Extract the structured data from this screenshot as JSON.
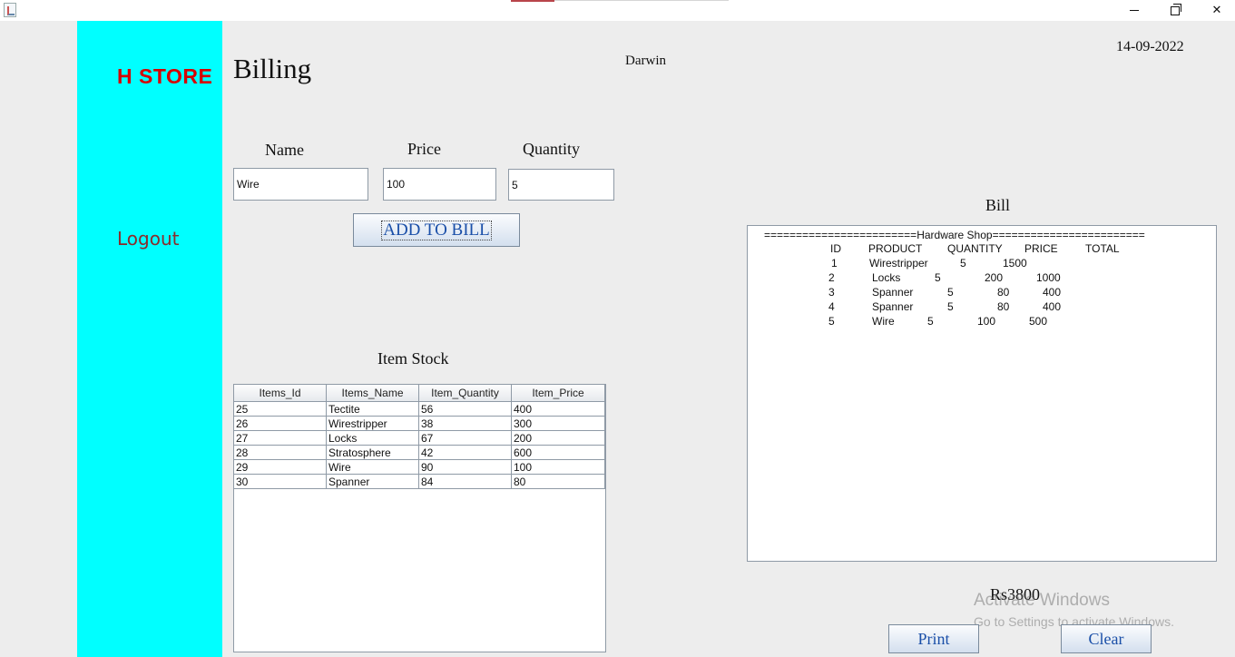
{
  "window": {
    "minimize_glyph": "",
    "restore_glyph": "",
    "close_glyph": "✕"
  },
  "sidebar": {
    "brand": "H STORE",
    "logout_label": "Logout"
  },
  "header": {
    "title": "Billing",
    "user": "Darwin",
    "date": "14-09-2022"
  },
  "form": {
    "name_label": "Name",
    "price_label": "Price",
    "quantity_label": "Quantity",
    "name_value": "Wire",
    "price_value": "100",
    "quantity_value": "5",
    "add_button": "ADD TO BILL"
  },
  "stock": {
    "title": "Item Stock",
    "columns": [
      "Items_Id",
      "Items_Name",
      "Item_Quantity",
      "Item_Price"
    ],
    "rows": [
      [
        "25",
        "Tectite",
        "56",
        "400"
      ],
      [
        "26",
        "Wirestripper",
        "38",
        "300"
      ],
      [
        "27",
        "Locks",
        "67",
        "200"
      ],
      [
        "28",
        "Stratosphere",
        "42",
        "600"
      ],
      [
        "29",
        "Wire",
        "90",
        "100"
      ],
      [
        "30",
        "Spanner",
        "84",
        "80"
      ]
    ]
  },
  "bill": {
    "title": "Bill",
    "banner": "========================Hardware Shop========================",
    "headers": [
      "ID",
      "PRODUCT",
      "QUANTITY",
      "PRICE",
      "TOTAL"
    ],
    "rows": [
      [
        "1",
        "Wirestripper",
        "5",
        "1500",
        ""
      ],
      [
        "2",
        "Locks",
        "5",
        "200",
        "1000"
      ],
      [
        "3",
        "Spanner",
        "5",
        "80",
        "400"
      ],
      [
        "4",
        "Spanner",
        "5",
        "80",
        "400"
      ],
      [
        "5",
        "Wire",
        "5",
        "100",
        "500"
      ]
    ],
    "total": "Rs3800",
    "print_button": "Print",
    "clear_button": "Clear"
  },
  "watermark": {
    "line1": "Activate Windows",
    "line2": "Go to Settings to activate Windows."
  }
}
